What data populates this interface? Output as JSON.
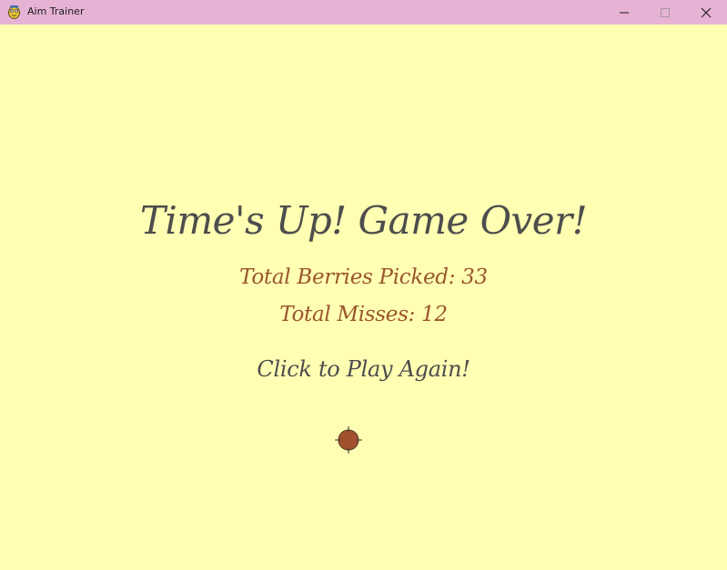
{
  "window": {
    "title": "Aim Trainer",
    "icon": "pygame-snake-icon",
    "controls": {
      "minimize_icon": "minimize-icon",
      "maximize_icon": "maximize-icon",
      "close_icon": "close-icon"
    },
    "colors": {
      "titlebar": "#e6b3d4",
      "background": "#ffffb3"
    }
  },
  "game_over": {
    "headline": "Time's Up! Game Over!",
    "berries_picked": "Total Berries Picked: 33",
    "misses": "Total Misses: 12",
    "play_again": "Click to Play Again!",
    "cursor_icon": "crosshair-berry-cursor",
    "colors": {
      "headline": "#4d4d4d",
      "stats": "#99552e",
      "cursor_fill": "#a0522d"
    }
  }
}
